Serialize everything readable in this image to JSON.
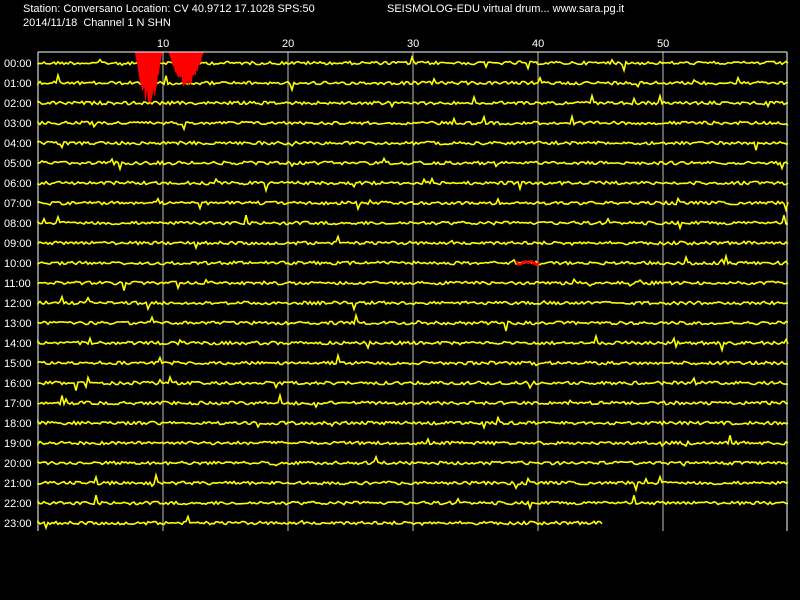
{
  "header": {
    "station_line": "Station: Conversano Location: CV 40.9712 17.1028 SPS:50",
    "title_line": "SEISMOLOG-EDU virtual drum... www.sara.pg.it",
    "date_line": "2014/11/18  Channel 1 N SHN"
  },
  "colors": {
    "background": "#000000",
    "trace": "#ffff00",
    "event": "#ff0000",
    "grid": "#ffffff",
    "text": "#ffffff"
  },
  "chart_data": {
    "type": "line",
    "title": "",
    "xlabel": "",
    "ylabel": "",
    "x_ticks": [
      10,
      20,
      30,
      40,
      50
    ],
    "x_range": [
      0,
      60
    ],
    "grid": true,
    "rows": [
      "00:00",
      "01:00",
      "02:00",
      "03:00",
      "04:00",
      "05:00",
      "06:00",
      "07:00",
      "08:00",
      "09:00",
      "10:00",
      "11:00",
      "12:00",
      "13:00",
      "14:00",
      "15:00",
      "16:00",
      "17:00",
      "18:00",
      "19:00",
      "20:00",
      "21:00",
      "22:00",
      "23:00"
    ],
    "last_row_end_minute": 45.2,
    "events": [
      {
        "row": "00:00",
        "start_minute": 7.8,
        "end_minute": 9.9,
        "rows_spanned": 3
      },
      {
        "row": "00:00",
        "start_minute": 10.5,
        "end_minute": 13.2,
        "rows_spanned": 2
      },
      {
        "row": "10:00",
        "start_minute": 38.3,
        "end_minute": 40.1,
        "rows_spanned": 1
      }
    ]
  }
}
